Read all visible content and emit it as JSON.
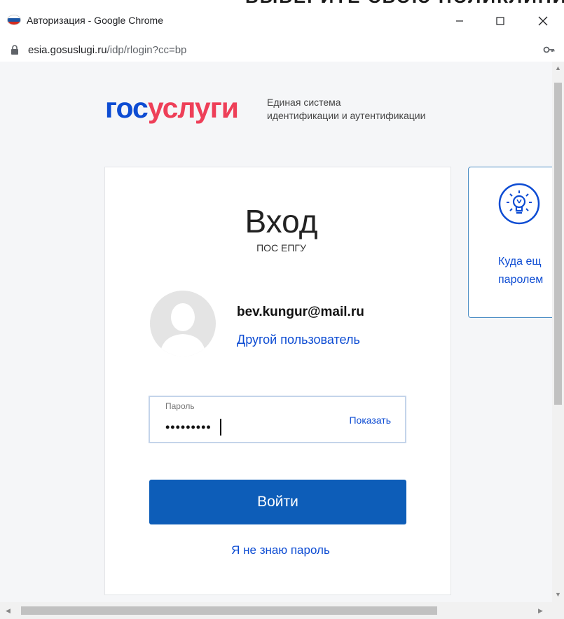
{
  "window": {
    "title": "Авторизация - Google Chrome",
    "background_text": "ВЫБЕРИТЕ СВОЮ ПОЛИКЛИНИКУ"
  },
  "address": {
    "host": "esia.gosuslugi.ru",
    "path": "/idp/rlogin?cc=bp"
  },
  "brand": {
    "logo_part1": "гос",
    "logo_part2": "услуги",
    "tagline_line1": "Единая система",
    "tagline_line2": "идентификации и аутентификации"
  },
  "login": {
    "title": "Вход",
    "subtitle": "ПОС ЕПГУ",
    "email": "bev.kungur@mail.ru",
    "other_user": "Другой пользователь",
    "password_label": "Пароль",
    "password_value": "•••••••••",
    "show_label": "Показать",
    "submit_label": "Войти",
    "forgot_label": "Я не знаю пароль"
  },
  "side": {
    "line1": "Куда ещ",
    "line2": "паролем"
  },
  "colors": {
    "brand_blue": "#0d4cd3",
    "brand_red": "#ee3f58",
    "button_blue": "#0d5db8"
  },
  "icons": {
    "flag": "russia-flag-icon",
    "lock": "lock-icon",
    "key": "key-icon",
    "lightbulb": "lightbulb-icon",
    "avatar": "user-silhouette-icon"
  }
}
